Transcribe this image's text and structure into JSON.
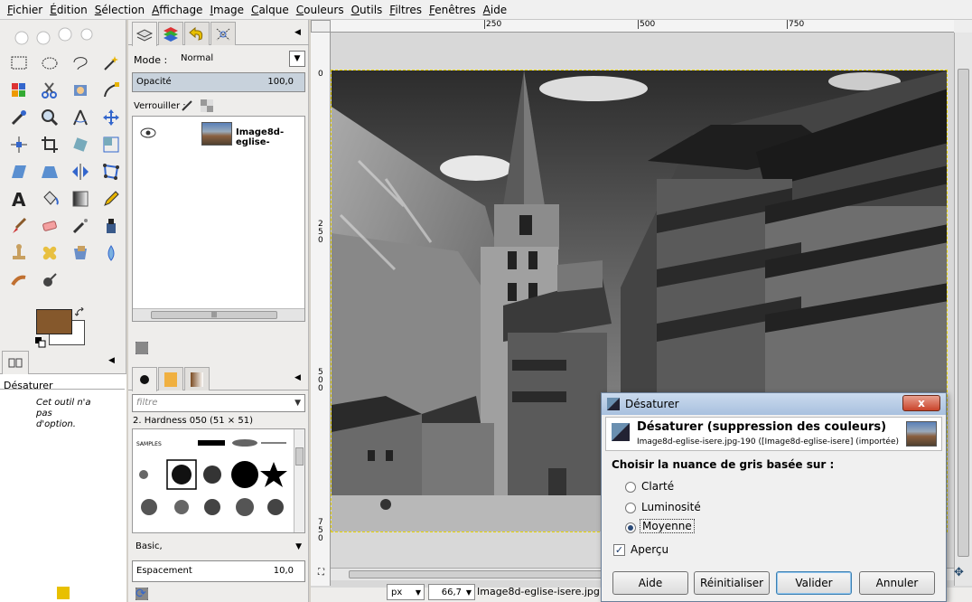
{
  "menu": [
    "Fichier",
    "Édition",
    "Sélection",
    "Affichage",
    "Image",
    "Calque",
    "Couleurs",
    "Outils",
    "Filtres",
    "Fenêtres",
    "Aide"
  ],
  "toolbox": {
    "tool_options_title": "Désaturer",
    "tool_options_text": "Cet outil n'a pas d'option.",
    "fg_color": "#85582c",
    "bg_color": "#ffffff"
  },
  "layers": {
    "mode_label": "Mode :",
    "mode_value": "Normal",
    "opacity_label": "Opacité",
    "opacity_value": "100,0",
    "lock_label": "Verrouiller :",
    "layer_name": "Image8d-eglise-"
  },
  "brushes": {
    "filter_placeholder": "filtre",
    "brush_name": "2. Hardness 050 (51 × 51)",
    "preset": "Basic,",
    "spacing_label": "Espacement",
    "spacing_value": "10,0"
  },
  "canvas": {
    "ruler_h": [
      "250",
      "500",
      "750"
    ],
    "ruler_v": [
      "0",
      "250",
      "500",
      "750"
    ],
    "unit": "px",
    "zoom": "66,7 %",
    "filename": "Image8d-eglise-isere.jpg"
  },
  "dialog": {
    "window_title": "Désaturer",
    "close_label": "x",
    "heading": "Désaturer (suppression des couleurs)",
    "subheading": "Image8d-eglise-isere.jpg-190 ([Image8d-eglise-isere] (importée)",
    "group_label": "Choisir la nuance de gris basée sur :",
    "options": [
      "Clarté",
      "Luminosité",
      "Moyenne"
    ],
    "selected_option": "Moyenne",
    "preview_label": "Aperçu",
    "preview_checked": true,
    "buttons": [
      "Aide",
      "Réinitialiser",
      "Valider",
      "Annuler"
    ]
  }
}
